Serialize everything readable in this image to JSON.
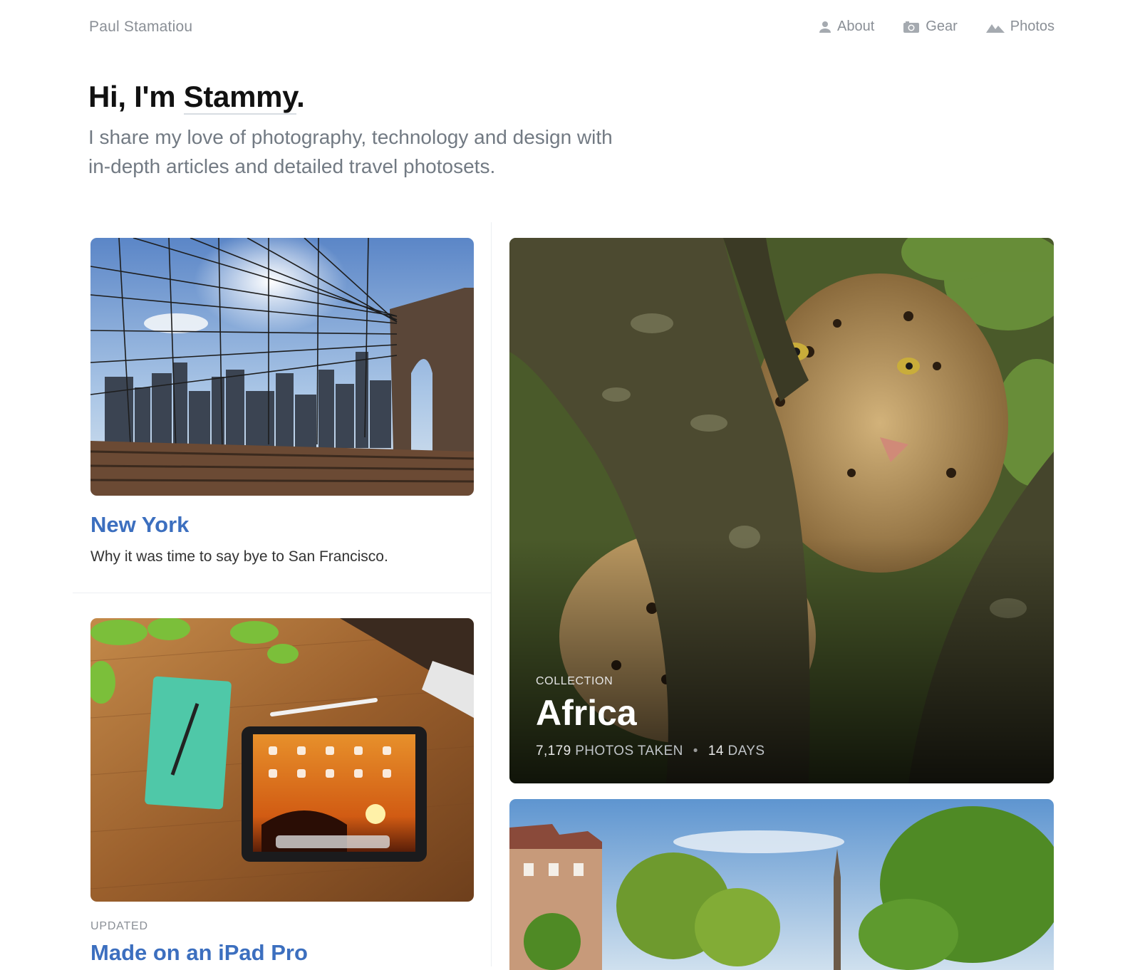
{
  "header": {
    "site_name": "Paul Stamatiou",
    "nav": [
      {
        "label": "About",
        "icon": "person-icon"
      },
      {
        "label": "Gear",
        "icon": "camera-icon"
      },
      {
        "label": "Photos",
        "icon": "mountain-icon"
      }
    ]
  },
  "intro": {
    "title_prefix": "Hi, I'm ",
    "title_name": "Stammy",
    "title_suffix": ".",
    "subtitle": "I share my love of photography, technology and design with in-depth articles and detailed travel photosets."
  },
  "cards": {
    "new_york": {
      "title": "New York",
      "description": "Why it was time to say bye to San Francisco."
    },
    "ipad": {
      "kicker": "UPDATED",
      "title": "Made on an iPad Pro"
    }
  },
  "feature": {
    "kicker": "COLLECTION",
    "title": "Africa",
    "photos_count": "7,179",
    "photos_label": "PHOTOS TAKEN",
    "separator": "•",
    "days_count": "14",
    "days_label": "DAYS"
  },
  "colors": {
    "link_blue": "#3c6fbf",
    "muted_gray": "#8a8f96"
  }
}
